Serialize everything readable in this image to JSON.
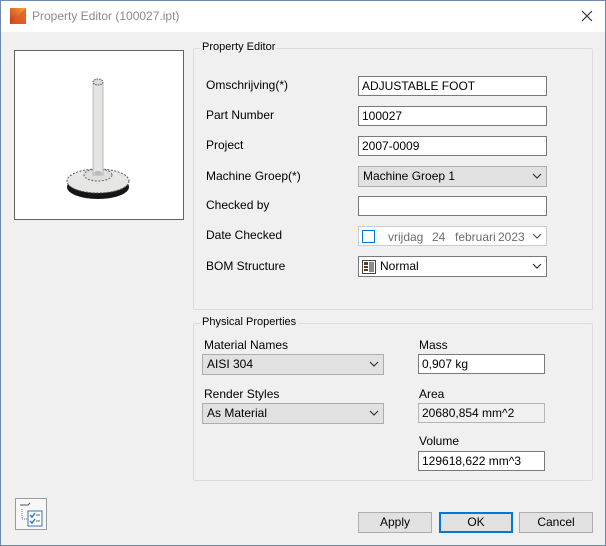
{
  "window": {
    "title": "Property Editor (100027.ipt)"
  },
  "property_editor": {
    "group_label": "Property Editor",
    "fields": {
      "description": {
        "label": "Omschrijving(*)",
        "value": "ADJUSTABLE FOOT"
      },
      "part_number": {
        "label": "Part Number",
        "value": "100027"
      },
      "project": {
        "label": "Project",
        "value": "2007-0009"
      },
      "machine_group": {
        "label": "Machine Groep(*)",
        "value": "Machine Groep 1"
      },
      "checked_by": {
        "label": "Checked by",
        "value": ""
      },
      "date_checked": {
        "label": "Date Checked",
        "weekday": "vrijdag",
        "day": "24",
        "month": "februari",
        "year": "2023"
      },
      "bom_structure": {
        "label": "BOM Structure",
        "value": "Normal"
      }
    }
  },
  "physical": {
    "group_label": "Physical Properties",
    "material_label": "Material Names",
    "material_value": "AISI 304",
    "render_label": "Render Styles",
    "render_value": "As Material",
    "mass_label": "Mass",
    "mass_value": "0,907 kg",
    "area_label": "Area",
    "area_value": "20680,854 mm^2",
    "volume_label": "Volume",
    "volume_value": "129618,622 mm^3"
  },
  "buttons": {
    "apply": "Apply",
    "ok": "OK",
    "cancel": "Cancel"
  },
  "icons": {
    "app": "inventor-app-icon",
    "close": "close-icon",
    "checklist": "checklist-icon",
    "bom": "bom-structure-icon"
  }
}
